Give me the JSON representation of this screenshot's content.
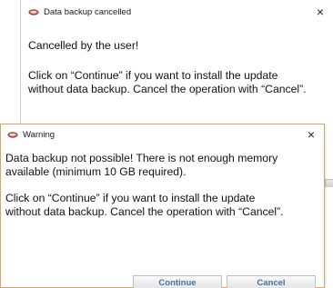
{
  "back_dialog": {
    "title": "Data backup cancelled",
    "close_glyph": "×",
    "message_1": "Cancelled by the user!",
    "message_2_line_1": "Click on “Continue” if you want to install the update",
    "message_2_line_2": "without data backup. Cancel the operation with “Cancel”.",
    "icon": "app-icon"
  },
  "front_dialog": {
    "title": "Warning",
    "close_glyph": "×",
    "message_1_line_1": "Data backup not possible! There is not enough memory",
    "message_1_line_2": "available (minimum 10 GB required).",
    "message_2_line_1": "Click on “Continue” if you want to install the update",
    "message_2_line_2": "without data backup. Cancel the operation with “Cancel”.",
    "icon": "app-icon",
    "buttons": {
      "continue_label": "Continue",
      "cancel_label": "Cancel"
    },
    "border_color": "#d1a866",
    "button_text_color": "#4b6f99"
  }
}
